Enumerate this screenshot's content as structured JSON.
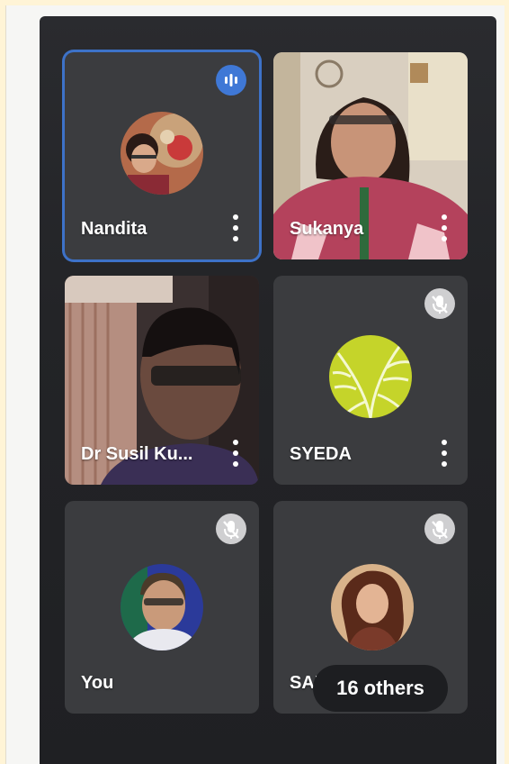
{
  "participants": [
    {
      "name": "Nandita",
      "status": "speaking"
    },
    {
      "name": "Sukanya",
      "status": "video"
    },
    {
      "name": "Dr Susil Ku...",
      "status": "video"
    },
    {
      "name": "SYEDA",
      "status": "muted"
    },
    {
      "name": "You",
      "status": "muted"
    },
    {
      "name": "SABNA",
      "status": "muted"
    }
  ],
  "others_label": "16 others",
  "colors": {
    "speaking_border": "#3d72c8",
    "tile_bg": "#3b3c3f",
    "screen_bg": "#232427"
  }
}
